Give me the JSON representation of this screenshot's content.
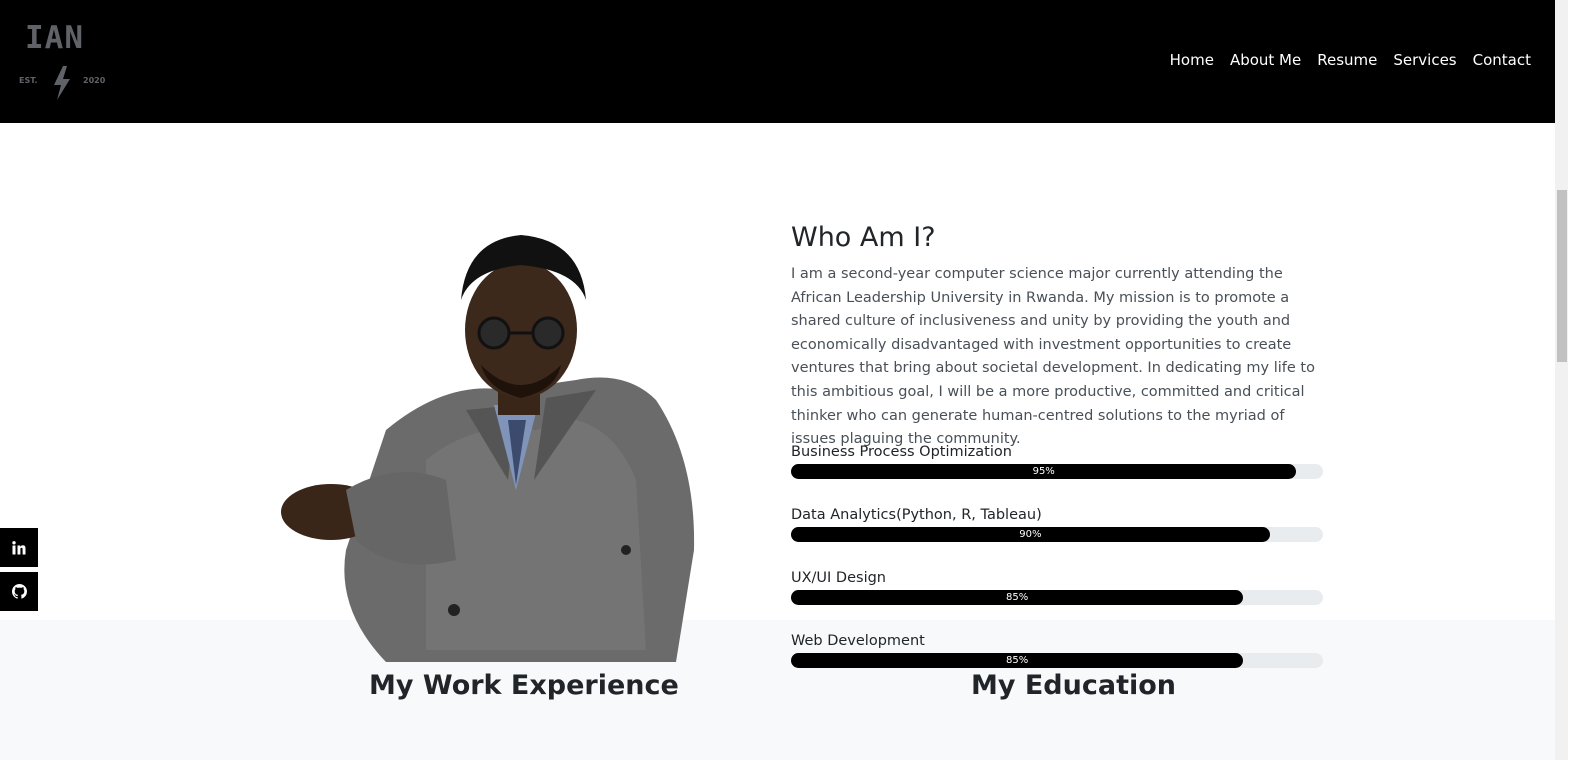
{
  "brand": {
    "name": "IAN",
    "est": "EST.",
    "year": "2020"
  },
  "nav": {
    "items": [
      {
        "label": "Home"
      },
      {
        "label": "About Me"
      },
      {
        "label": "Resume"
      },
      {
        "label": "Services"
      },
      {
        "label": "Contact"
      }
    ]
  },
  "about": {
    "heading": "Who Am I?",
    "bio": "I am a second-year computer science major currently attending the African Leadership University in Rwanda. My mission is to promote a shared culture of inclusiveness and unity by providing the youth and economically disadvantaged with investment opportunities to create ventures that bring about societal development. In dedicating my life to this ambitious goal, I will be a more productive, committed and critical thinker who can generate human-centred solutions to the myriad of issues plaguing the community."
  },
  "skills": [
    {
      "name": "Business Process Optimization",
      "percent": 95,
      "label": "95%"
    },
    {
      "name": "Data Analytics(Python, R, Tableau)",
      "percent": 90,
      "label": "90%"
    },
    {
      "name": "UX/UI Design",
      "percent": 85,
      "label": "85%"
    },
    {
      "name": "Web Development",
      "percent": 85,
      "label": "85%"
    }
  ],
  "sections": {
    "work_title": "My Work Experience",
    "education_title": "My Education"
  },
  "social": [
    {
      "icon": "linkedin-icon"
    },
    {
      "icon": "github-icon"
    }
  ],
  "colors": {
    "header_bg": "#000000",
    "bar_fill": "#000000",
    "bar_track": "#e9ecef",
    "section_bg": "#f8f9fa"
  }
}
